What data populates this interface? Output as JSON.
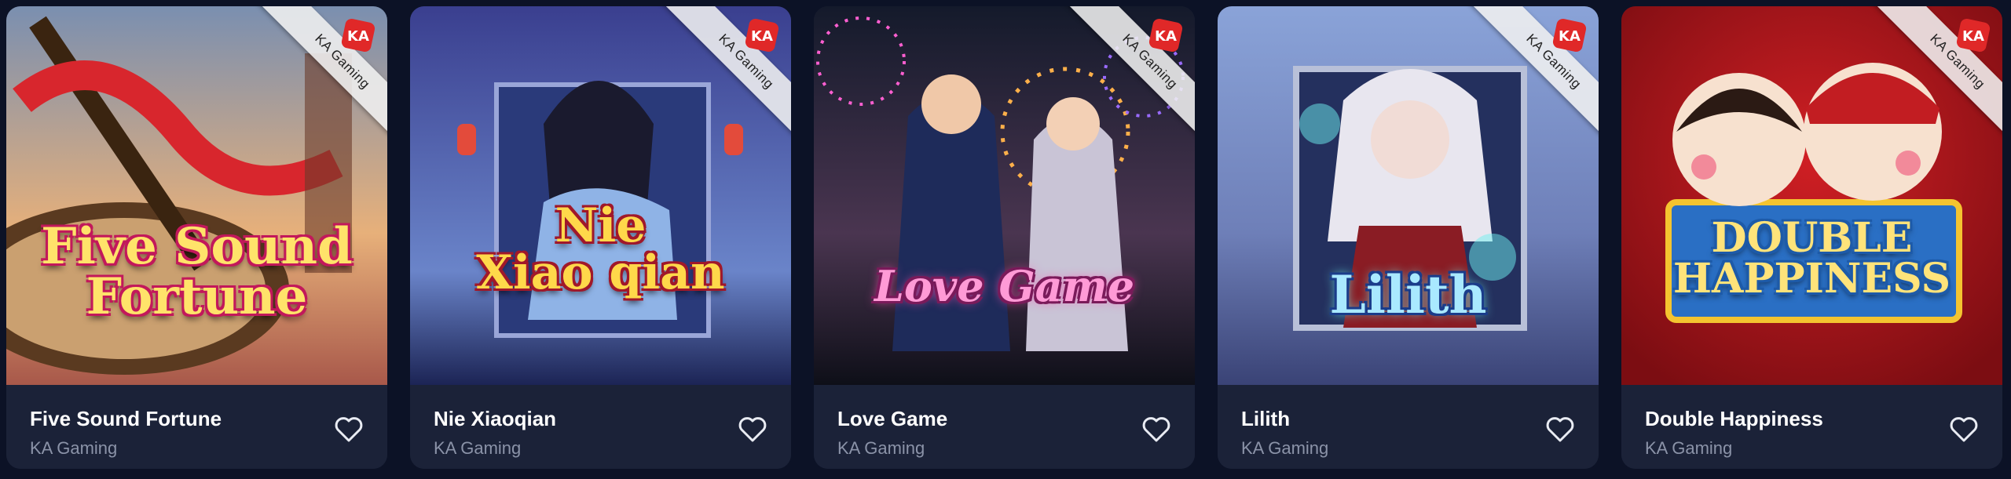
{
  "games": [
    {
      "title": "Five Sound Fortune",
      "provider": "KA Gaming",
      "art_title": "Five Sound\nFortune",
      "badge_text": "KA Gaming",
      "favorite_icon": "heart-outline-icon",
      "colors": {
        "sky_top": "#7a8fb0",
        "sky_bottom": "#e7b07a",
        "accent": "#d8262d",
        "title_fill": "#ffe36a",
        "title_stroke": "#c2185b"
      }
    },
    {
      "title": "Nie Xiaoqian",
      "provider": "KA Gaming",
      "art_title": "Nie\nXiao qian",
      "badge_text": "KA Gaming",
      "favorite_icon": "heart-outline-icon",
      "colors": {
        "sky_top": "#3a3f8f",
        "sky_bottom": "#6a84c9",
        "accent": "#d64a8b",
        "title_fill": "#ffd84a",
        "title_stroke": "#a0182a"
      }
    },
    {
      "title": "Love Game",
      "provider": "KA Gaming",
      "art_title": "Love Game",
      "badge_text": "KA Gaming",
      "favorite_icon": "heart-outline-icon",
      "colors": {
        "sky_top": "#141a2b",
        "sky_bottom": "#4a3550",
        "accent": "#ff4fb0",
        "title_fill": "#ff9ad6",
        "title_stroke": "#7a1a5a"
      }
    },
    {
      "title": "Lilith",
      "provider": "KA Gaming",
      "art_title": "Lilith",
      "badge_text": "KA Gaming",
      "favorite_icon": "heart-outline-icon",
      "colors": {
        "sky_top": "#8aa3d8",
        "sky_bottom": "#5f6ea8",
        "accent": "#6ef0f0",
        "title_fill": "#a9e9ff",
        "title_stroke": "#1a3c8a"
      }
    },
    {
      "title": "Double Happiness",
      "provider": "KA Gaming",
      "art_title": "DOUBLE\nHAPPINESS",
      "badge_text": "KA Gaming",
      "favorite_icon": "heart-outline-icon",
      "colors": {
        "sky_top": "#b5161b",
        "sky_bottom": "#8c0f14",
        "accent": "#f4c430",
        "title_fill": "#ffe37a",
        "title_stroke": "#1d5aa8"
      }
    }
  ]
}
